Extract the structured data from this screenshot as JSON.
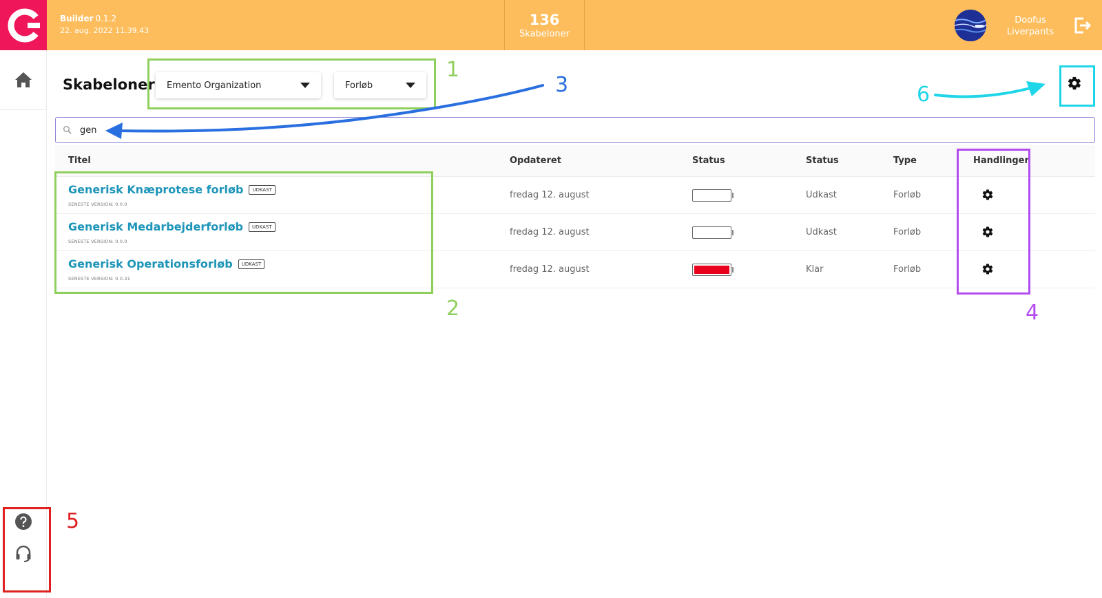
{
  "header": {
    "app_name": "Builder",
    "app_version": "0.1.2",
    "build_date": "22. aug. 2022 11.39.43",
    "counter_value": "136",
    "counter_label": "Skabeloner",
    "user_first": "Doofus",
    "user_last": "Liverpants",
    "colors": {
      "header_bg": "#fdbd5c",
      "logo_bg": "#ef1659"
    }
  },
  "sidebar": {
    "home_icon": "home-icon",
    "help_icon": "help-icon",
    "support_icon": "headset-icon"
  },
  "page": {
    "title": "Skabeloner",
    "filters": {
      "organization": "Emento Organization",
      "type": "Forløb"
    },
    "settings_icon": "gear-icon"
  },
  "search": {
    "value": "gen",
    "icon": "search-icon"
  },
  "table": {
    "columns": [
      "Titel",
      "Opdateret",
      "Status",
      "Status",
      "Type",
      "Handlinger"
    ],
    "rows": [
      {
        "title": "Generisk Knæprotese forløb",
        "badge": "UDKAST",
        "version": "SENESTE VERSION: 0.0.0",
        "updated": "fredag 12. august",
        "status_indicator": "empty",
        "status": "Udkast",
        "type": "Forløb"
      },
      {
        "title": "Generisk Medarbejderforløb",
        "badge": "UDKAST",
        "version": "SENESTE VERSION: 0.0.0",
        "updated": "fredag 12. august",
        "status_indicator": "empty",
        "status": "Udkast",
        "type": "Forløb"
      },
      {
        "title": "Generisk Operationsforløb",
        "badge": "UDKAST",
        "version": "SENESTE VERSION: 0.0.31",
        "updated": "fredag 12. august",
        "status_indicator": "full-red",
        "status": "Klar",
        "type": "Forløb"
      }
    ]
  },
  "annotations": {
    "labels": [
      "1",
      "2",
      "3",
      "4",
      "5",
      "6"
    ],
    "colors": {
      "1": "#8fcf5c",
      "2": "#8fcf5c",
      "3": "#2a6fe0",
      "4": "#b34cf0",
      "5": "#e01f1f",
      "6": "#1fd6e8"
    }
  }
}
